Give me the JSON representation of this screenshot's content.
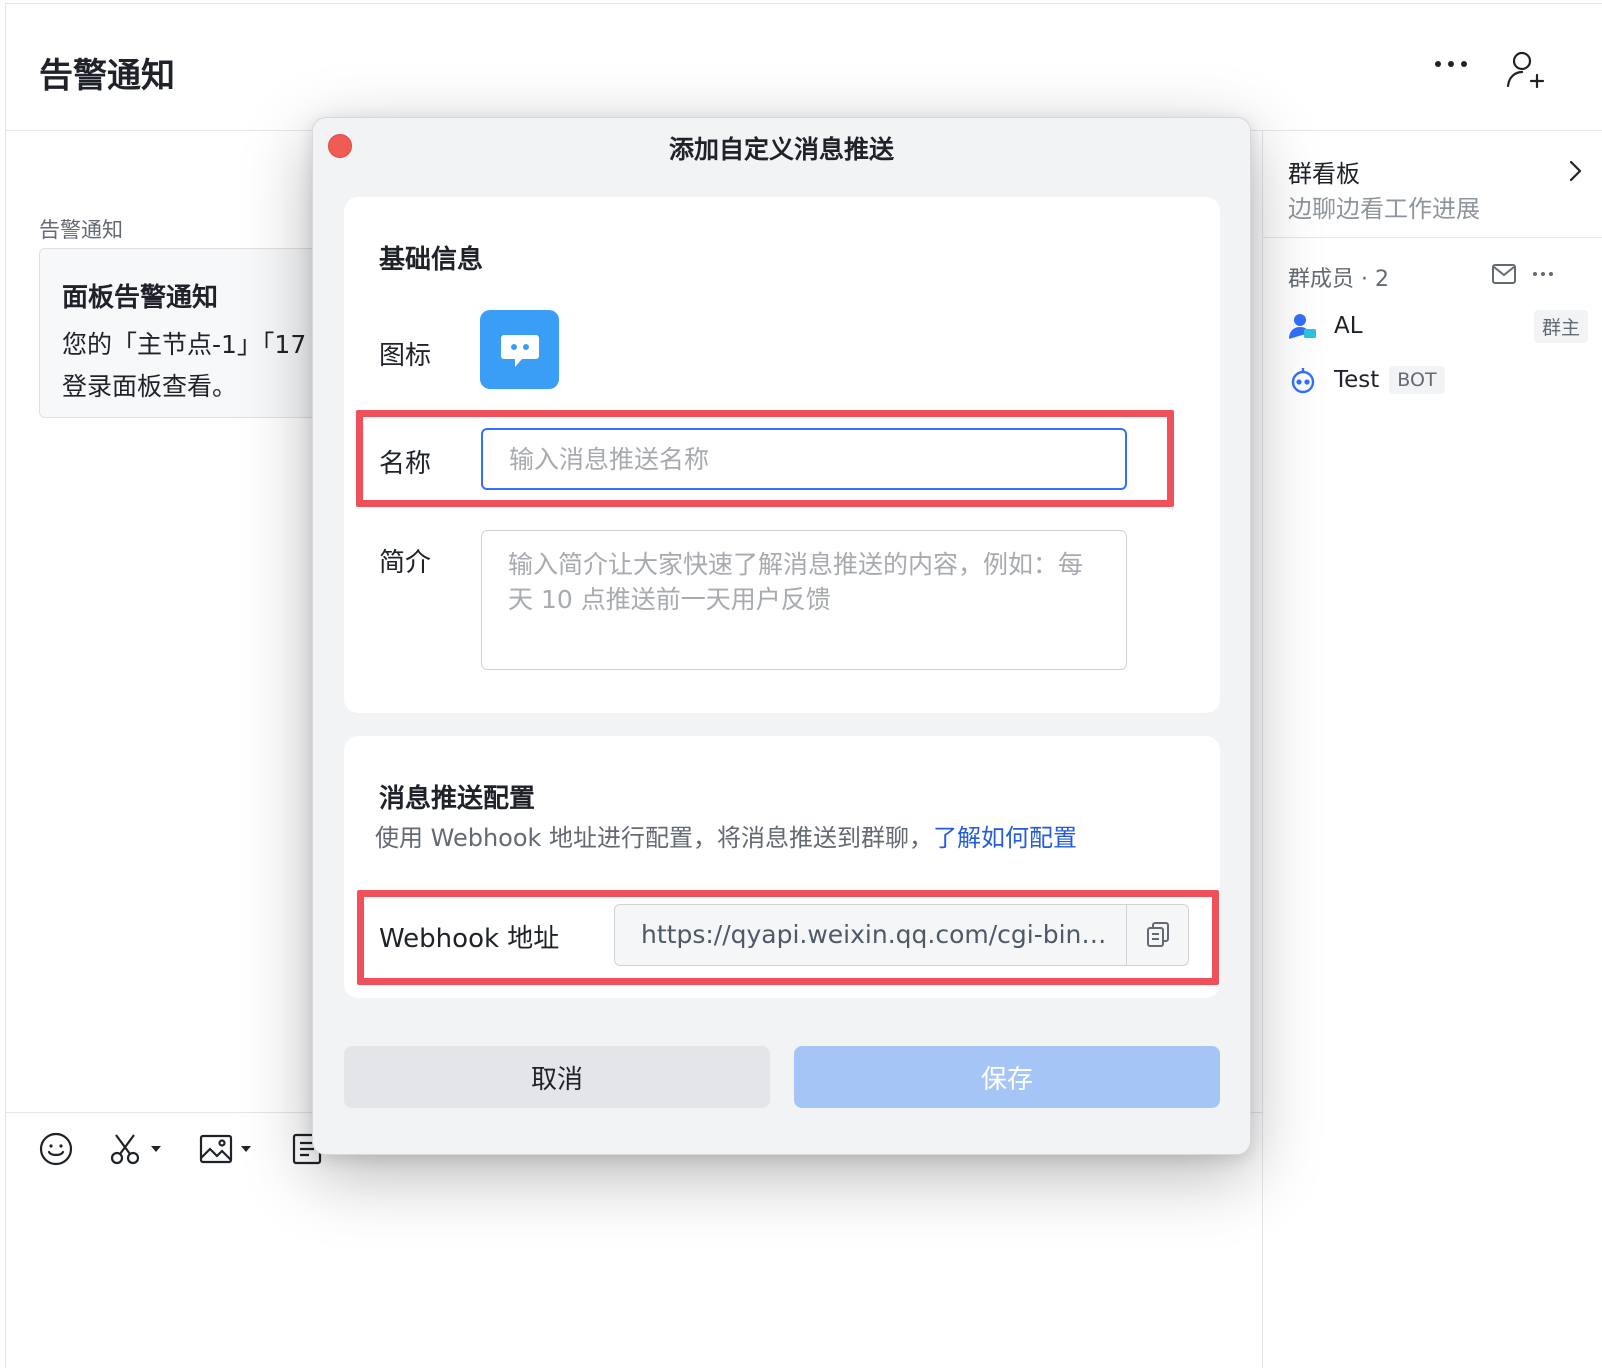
{
  "chat": {
    "title": "告警通知",
    "message": {
      "sender": "告警通知",
      "card_title": "面板告警通知",
      "line1": "您的「主节点-1」「17",
      "line2": "登录面板查看。"
    }
  },
  "header_icons": {
    "more": "more-horizontal-icon",
    "add_member": "add-user-icon"
  },
  "toolbar_icons": [
    "emoji-icon",
    "scissors-icon",
    "image-icon",
    "document-icon"
  ],
  "sidebar": {
    "board_title": "群看板",
    "board_subtitle": "边聊边看工作进展",
    "members_title": "群成员 · 2",
    "members": [
      {
        "name": "AL",
        "tag": "群主"
      },
      {
        "name": "Test",
        "tag": "BOT"
      }
    ]
  },
  "modal": {
    "title": "添加自定义消息推送",
    "basic": {
      "heading": "基础信息",
      "icon_label": "图标",
      "name_label": "名称",
      "name_placeholder": "输入消息推送名称",
      "name_value": "",
      "intro_label": "简介",
      "intro_placeholder": "输入简介让大家快速了解消息推送的内容，例如：每天 10 点推送前一天用户反馈"
    },
    "push": {
      "heading": "消息推送配置",
      "desc": "使用 Webhook 地址进行配置，将消息推送到群聊，",
      "link": "了解如何配置",
      "webhook_label": "Webhook 地址",
      "webhook_url": "https://qyapi.weixin.qq.com/cgi-bin/..."
    },
    "cancel": "取消",
    "save": "保存"
  },
  "colors": {
    "accent": "#3370ff",
    "link": "#245bdb",
    "save_disabled": "#a6c5f7",
    "highlight": "#f0505a",
    "bot_icon": "#3a9df6"
  }
}
